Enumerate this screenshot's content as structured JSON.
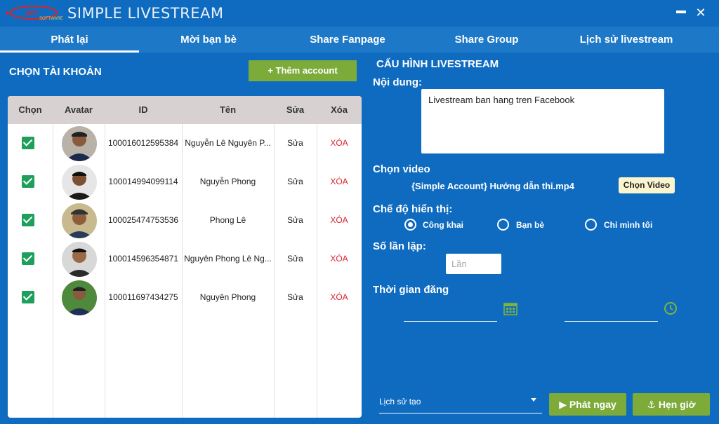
{
  "app": {
    "title": "SIMPLE LIVESTREAM",
    "logo_text": "ATP SOFTWARE",
    "minimize_label": "",
    "close_label": "✕"
  },
  "tabs": [
    {
      "label": "Phát lại",
      "active": true
    },
    {
      "label": "Mời bạn bè",
      "active": false
    },
    {
      "label": "Share Fanpage",
      "active": false
    },
    {
      "label": "Share Group",
      "active": false
    },
    {
      "label": "Lịch sử livestream",
      "active": false
    }
  ],
  "accounts": {
    "heading": "CHỌN TÀI KHOẢN",
    "add_button": "+ Thêm account",
    "columns": [
      "Chọn",
      "Avatar",
      "ID",
      "Tên",
      "Sửa",
      "Xóa"
    ],
    "rows": [
      {
        "checked": true,
        "id": "100016012595384",
        "name": "Nguyễn Lê Nguyên P...",
        "edit": "Sửa",
        "delete": "XÓA"
      },
      {
        "checked": true,
        "id": "100014994099114",
        "name": "Nguyễn Phong",
        "edit": "Sửa",
        "delete": "XÓA"
      },
      {
        "checked": true,
        "id": "100025474753536",
        "name": "Phong Lê",
        "edit": "Sửa",
        "delete": "XÓA"
      },
      {
        "checked": true,
        "id": "100014596354871",
        "name": "Nguyên Phong Lê Ng...",
        "edit": "Sửa",
        "delete": "XÓA"
      },
      {
        "checked": true,
        "id": "100011697434275",
        "name": "Nguyên Phong",
        "edit": "Sửa",
        "delete": "XÓA"
      }
    ]
  },
  "config": {
    "heading": "CẤU HÌNH LIVESTREAM",
    "content_label": "Nội dung:",
    "content_value": "Livestream ban hang tren Facebook",
    "video_label": "Chọn video",
    "video_name": "{Simple Account} Hướng dẫn thi.mp4",
    "choose_video_button": "Chọn Video",
    "visibility_label": "Chế độ hiển thị:",
    "visibility_options": [
      {
        "label": "Công khai",
        "checked": true
      },
      {
        "label": "Bạn bè",
        "checked": false
      },
      {
        "label": "Chỉ mình tôi",
        "checked": false
      }
    ],
    "repeat_label": "Số lần lặp:",
    "repeat_placeholder": "Lần",
    "post_time_label": "Thời gian đăng",
    "history_select": "Lịch sử tạo",
    "play_now_button": "▶ Phát ngay",
    "schedule_button": "⚓ Hẹn giờ"
  },
  "colors": {
    "background": "#0f6bbf",
    "tabbar": "#1d78c8",
    "button_green": "#7cab3a",
    "checkbox_green": "#1f9f5c",
    "delete_red": "#d9242c",
    "table_header": "#d7d2d1",
    "icon_green": "#7cb342"
  },
  "icons": {
    "date_picker": "calendar-icon",
    "time_picker": "clock-icon"
  }
}
